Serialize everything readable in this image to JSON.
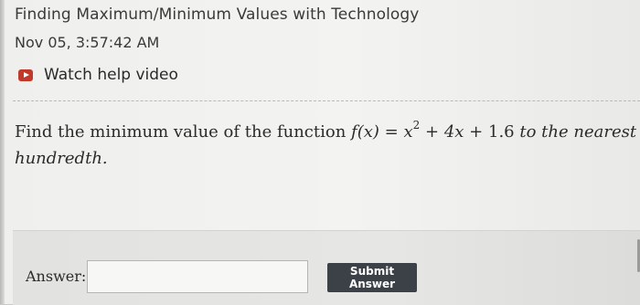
{
  "header": {
    "title": "Finding Maximum/Minimum Values with Technology",
    "timestamp": "Nov 05, 3:57:42 AM",
    "help_link_label": "Watch help video",
    "help_icon": "play-video-icon"
  },
  "question": {
    "prefix": "Find the minimum value of the function",
    "math": {
      "lhs": "f(x)",
      "equals": "=",
      "term1": "x",
      "term1_exp": "2",
      "plus1": "+",
      "term2": "4x",
      "plus2": "+",
      "term3": "1.6"
    },
    "suffix_line1": "to the nearest",
    "suffix_line2": "hundredth."
  },
  "answer": {
    "label": "Answer:",
    "input_value": "",
    "input_placeholder": "",
    "submit_label": "Submit Answer"
  },
  "colors": {
    "submit_button_bg": "#3b4147",
    "help_icon_red": "#c0392b"
  }
}
